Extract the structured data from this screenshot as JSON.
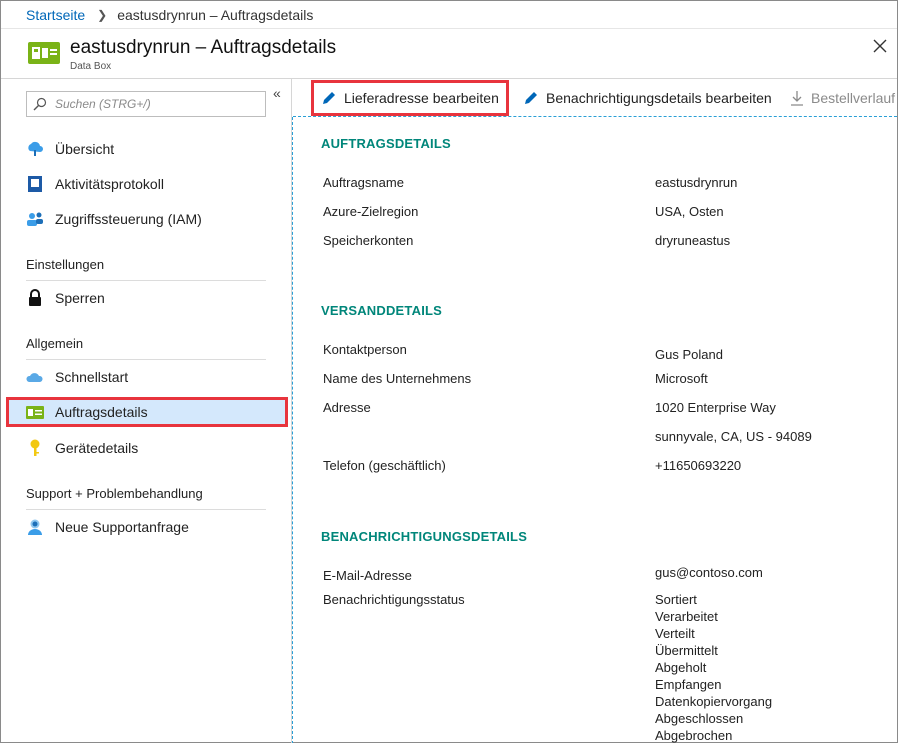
{
  "breadcrumb": {
    "home": "Startseite",
    "current": "eastusdrynrun – Auftragsdetails"
  },
  "header": {
    "title": "eastusdrynrun – Auftragsdetails",
    "subtitle": "Data Box"
  },
  "sidebar": {
    "search_placeholder": "Suchen (STRG+/)",
    "items": [
      {
        "label": "Übersicht"
      },
      {
        "label": "Aktivitätsprotokoll"
      },
      {
        "label": "Zugriffssteuerung (IAM)"
      },
      {
        "label": "Sperren"
      },
      {
        "label": "Schnellstart"
      },
      {
        "label": "Auftragsdetails"
      },
      {
        "label": "Gerätedetails"
      },
      {
        "label": "Neue Supportanfrage"
      }
    ],
    "sections": [
      "Einstellungen",
      "Allgemein",
      "Support + Problembehandlung"
    ]
  },
  "toolbar": {
    "edit_address": "Lieferadresse bearbeiten",
    "edit_notifications": "Benachrichtigungsdetails bearbeiten",
    "order_history": "Bestellverlauf h"
  },
  "order": {
    "title": "AUFTRAGSDETAILS",
    "rows": [
      {
        "label": "Auftragsname",
        "value": "eastusdrynrun"
      },
      {
        "label": "Azure-Zielregion",
        "value": "USA, Osten"
      },
      {
        "label": "Speicherkonten",
        "value": "dryruneastus"
      }
    ]
  },
  "shipping": {
    "title": "VERSANDDETAILS",
    "rows": [
      {
        "label": "Kontaktperson",
        "value": "Gus Poland"
      },
      {
        "label": "Name des Unternehmens",
        "value": "Microsoft"
      },
      {
        "label": "Adresse",
        "value": "1020 Enterprise Way"
      },
      {
        "label": "",
        "value": "sunnyvale, CA, US - 94089"
      },
      {
        "label": "Telefon (geschäftlich)",
        "value": "+11650693220"
      }
    ]
  },
  "notification": {
    "title": "BENACHRICHTIGUNGSDETAILS",
    "email_label": "E-Mail-Adresse",
    "email_value": "gus@contoso.com",
    "status_label": "Benachrichtigungsstatus",
    "statuses": [
      "Sortiert",
      "Verarbeitet",
      "Verteilt",
      "Übermittelt",
      "Abgeholt",
      "Empfangen",
      "Datenkopiervorgang",
      "Abgeschlossen",
      "Abgebrochen"
    ]
  },
  "colors": {
    "accent": "#0067b8",
    "section_title": "#00867a",
    "highlight": "#e8343d",
    "active_bg": "#d4e8fc"
  }
}
